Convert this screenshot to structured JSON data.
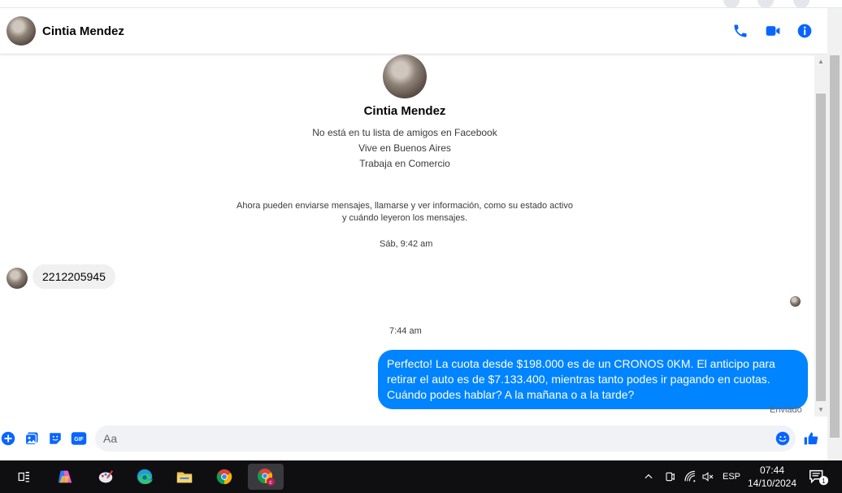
{
  "contact": {
    "name": "Cintia Mendez",
    "profile_lines": [
      "No está en tu lista de amigos en Facebook",
      "Vive en Buenos Aires",
      "Trabaja en Comercio"
    ],
    "notice_lines": [
      "Ahora pueden enviarse mensajes, llamarse y ver información, como su estado activo",
      "y cuándo leyeron los mensajes."
    ]
  },
  "header_icons": [
    "phone-icon",
    "video-icon",
    "info-icon"
  ],
  "messages": [
    {
      "timestamp": "Sáb, 9:42 am",
      "direction": "incoming",
      "text": "2212205945"
    },
    {
      "timestamp": "7:44 am",
      "direction": "outgoing",
      "text": "Perfecto! La cuota desde $198.000 es de un CRONOS 0KM. El anticipo para retirar el auto es de $7.133.400, mientras tanto podes ir pagando en cuotas. Cuándo podes hablar? A la mañana o a la tarde?",
      "status": "Enviado"
    }
  ],
  "composer": {
    "placeholder": "Aa",
    "gif_label": "GIF"
  },
  "colors": {
    "accent": "#0084ff",
    "icon_blue": "#0866ff",
    "incoming_bubble": "#f0f0f0"
  },
  "taskbar": {
    "language": "ESP",
    "time": "07:44",
    "date": "14/10/2024",
    "notification_count": "1"
  }
}
